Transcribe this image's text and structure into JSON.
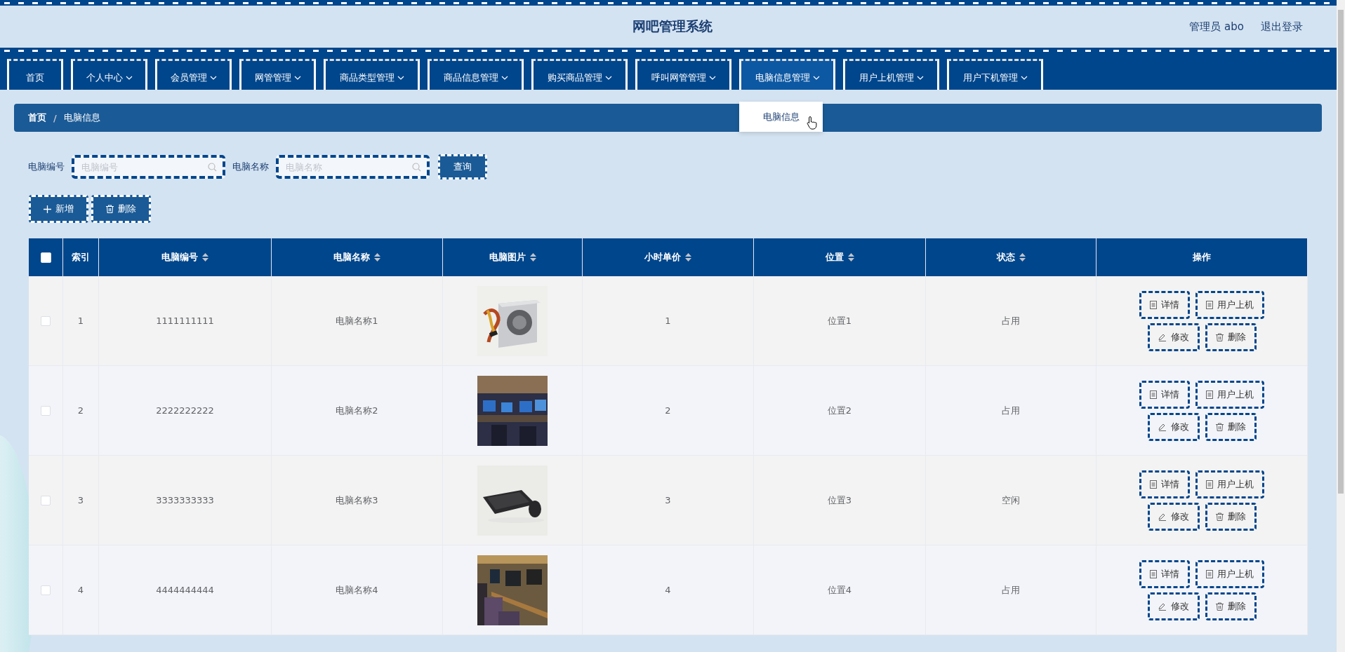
{
  "header": {
    "title": "网吧管理系统",
    "user": "管理员 abo",
    "logout": "退出登录"
  },
  "nav": [
    {
      "label": "首页",
      "dropdown": false,
      "selected": false
    },
    {
      "label": "个人中心",
      "dropdown": true,
      "selected": false
    },
    {
      "label": "会员管理",
      "dropdown": true,
      "selected": false
    },
    {
      "label": "网管管理",
      "dropdown": true,
      "selected": false
    },
    {
      "label": "商品类型管理",
      "dropdown": true,
      "selected": false
    },
    {
      "label": "商品信息管理",
      "dropdown": true,
      "selected": false
    },
    {
      "label": "购买商品管理",
      "dropdown": true,
      "selected": false
    },
    {
      "label": "呼叫网管管理",
      "dropdown": true,
      "selected": false
    },
    {
      "label": "电脑信息管理",
      "dropdown": true,
      "selected": true
    },
    {
      "label": "用户上机管理",
      "dropdown": true,
      "selected": false
    },
    {
      "label": "用户下机管理",
      "dropdown": true,
      "selected": false
    }
  ],
  "dropdown_menu": {
    "items": [
      "电脑信息"
    ]
  },
  "breadcrumb": {
    "items": [
      "首页",
      "电脑信息"
    ],
    "separator": "/"
  },
  "search": {
    "fields": [
      {
        "label": "电脑编号",
        "placeholder": "电脑编号"
      },
      {
        "label": "电脑名称",
        "placeholder": "电脑名称"
      }
    ],
    "button": "查询"
  },
  "actions": [
    {
      "kind": "add",
      "label": "新增"
    },
    {
      "kind": "delete",
      "label": "删除"
    }
  ],
  "table": {
    "select_all": {
      "checked": false
    },
    "columns": [
      {
        "label": "索引",
        "sortable": false
      },
      {
        "label": "电脑编号",
        "sortable": true
      },
      {
        "label": "电脑名称",
        "sortable": true
      },
      {
        "label": "电脑图片",
        "sortable": true
      },
      {
        "label": "小时单价",
        "sortable": true
      },
      {
        "label": "位置",
        "sortable": true
      },
      {
        "label": "状态",
        "sortable": true
      },
      {
        "label": "操作",
        "sortable": false
      }
    ],
    "rows": [
      {
        "checked": false,
        "index": "1",
        "number": "1111111111",
        "name": "电脑名称1",
        "price": "1",
        "location": "位置1",
        "status": "占用",
        "actions": [
          {
            "kind": "detail",
            "label": "详情"
          },
          {
            "kind": "detail",
            "label": "用户上机"
          },
          {
            "kind": "edit",
            "label": "修改"
          },
          {
            "kind": "delete",
            "label": "删除"
          }
        ]
      },
      {
        "checked": false,
        "index": "2",
        "number": "2222222222",
        "name": "电脑名称2",
        "price": "2",
        "location": "位置2",
        "status": "占用",
        "actions": [
          {
            "kind": "detail",
            "label": "详情"
          },
          {
            "kind": "detail",
            "label": "用户上机"
          },
          {
            "kind": "edit",
            "label": "修改"
          },
          {
            "kind": "delete",
            "label": "删除"
          }
        ]
      },
      {
        "checked": false,
        "index": "3",
        "number": "3333333333",
        "name": "电脑名称3",
        "price": "3",
        "location": "位置3",
        "status": "空闲",
        "actions": [
          {
            "kind": "detail",
            "label": "详情"
          },
          {
            "kind": "detail",
            "label": "用户上机"
          },
          {
            "kind": "edit",
            "label": "修改"
          },
          {
            "kind": "delete",
            "label": "删除"
          }
        ]
      },
      {
        "checked": false,
        "index": "4",
        "number": "4444444444",
        "name": "电脑名称4",
        "price": "4",
        "location": "位置4",
        "status": "占用",
        "actions": [
          {
            "kind": "detail",
            "label": "详情"
          },
          {
            "kind": "detail",
            "label": "用户上机"
          },
          {
            "kind": "edit",
            "label": "修改"
          },
          {
            "kind": "delete",
            "label": "删除"
          }
        ]
      }
    ]
  }
}
